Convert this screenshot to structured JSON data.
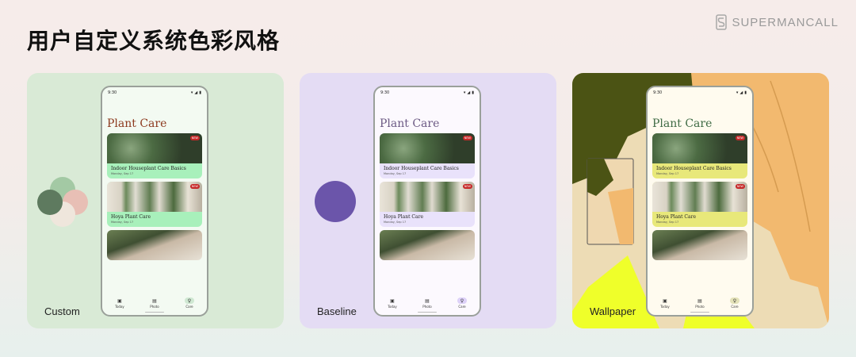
{
  "header": {
    "title": "用户自定义系统色彩风格",
    "brand": "SUPERMANCALL"
  },
  "panels": [
    {
      "label": "Custom",
      "bg": "#d9ead6",
      "title_color": "#8d3a1f",
      "card_color": "#a8f0bb",
      "nav_active": "#cfe8d2"
    },
    {
      "label": "Baseline",
      "bg": "#e4dcf4",
      "title_color": "#6c5a84",
      "card_color": "#e9e2fb",
      "nav_active": "#ddd1f8"
    },
    {
      "label": "Wallpaper",
      "bg": "#eddcb5",
      "title_color": "#3f6b45",
      "card_color": "#e8e87a",
      "nav_active": "#e4e2b8"
    }
  ],
  "phone": {
    "time": "9:30",
    "app_title": "Plant Care",
    "badge": "NEW",
    "cards": [
      {
        "title": "Indoor Houseplant Care Basics",
        "date": "Monday, Sep 17"
      },
      {
        "title": "Hoya Plant Care",
        "date": "Monday, Sep 17"
      }
    ],
    "nav": [
      {
        "label": "Today",
        "icon": "calendar-icon"
      },
      {
        "label": "Photo",
        "icon": "photo-icon"
      },
      {
        "label": "Care",
        "icon": "lightbulb-icon"
      }
    ]
  },
  "swatches": {
    "custom": [
      "#a3c9a4",
      "#e8bfb5",
      "#5e7a5f",
      "#efe6dc"
    ],
    "baseline": "#6b55aa",
    "wallpaper": [
      "#4b5314",
      "#f2b96f",
      "#efff2a",
      "#eddcb5"
    ]
  }
}
